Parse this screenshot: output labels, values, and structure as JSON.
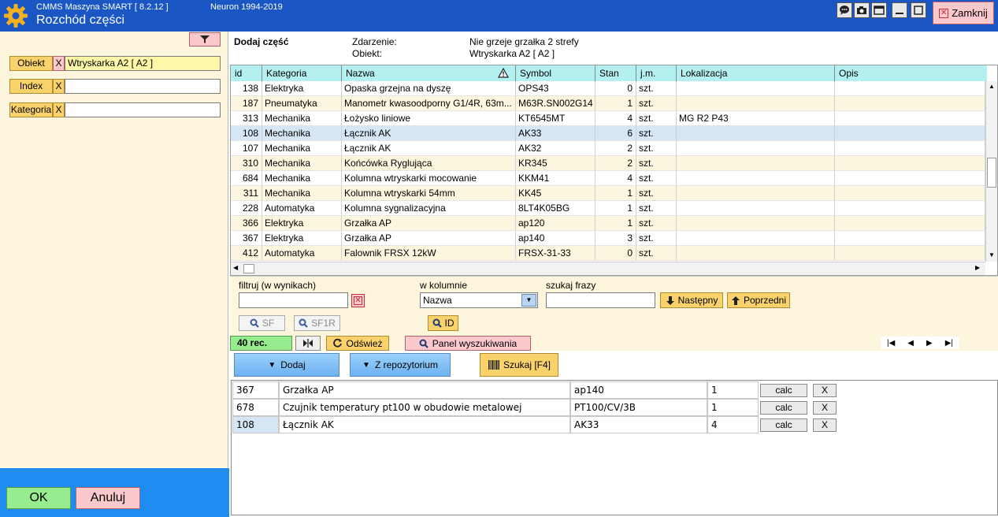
{
  "app": {
    "name": "CMMS Maszyna SMART  [  8.2.12 ]",
    "window_title": "Rozchód części",
    "copyright": "Neuron 1994-2019",
    "close_label": "Zamknij"
  },
  "filters": {
    "obiekt_label": "Obiekt",
    "obiekt_value": "Wtryskarka A2 [ A2 ]",
    "index_label": "Index",
    "index_value": "",
    "kategoria_label": "Kategoria",
    "kategoria_value": "",
    "x_label": "X"
  },
  "footer": {
    "ok_label": "OK",
    "cancel_label": "Anuluj"
  },
  "header": {
    "title": "Dodaj część",
    "zdarzenie_label": "Zdarzenie:",
    "zdarzenie_value": "Nie grzeje grzałka 2 strefy",
    "obiekt_label": "Obiekt:",
    "obiekt_value": "Wtryskarka A2 [ A2 ]"
  },
  "table": {
    "columns": [
      "id",
      "Kategoria",
      "Nazwa",
      "Symbol",
      "Stan",
      "j.m.",
      "Lokalizacja",
      "Opis"
    ],
    "rows": [
      {
        "id": "138",
        "kategoria": "Elektryka",
        "nazwa": "Opaska grzejna na dyszę",
        "symbol": "OPS43",
        "stan": "0",
        "jm": "szt.",
        "lokalizacja": "",
        "opis": ""
      },
      {
        "id": "187",
        "kategoria": "Pneumatyka",
        "nazwa": "Manometr kwasoodporny G1/4R, 63m...",
        "symbol": "M63R.SN002G14",
        "stan": "1",
        "jm": "szt.",
        "lokalizacja": "",
        "opis": ""
      },
      {
        "id": "313",
        "kategoria": "Mechanika",
        "nazwa": "Łożysko liniowe",
        "symbol": "KT6545MT",
        "stan": "4",
        "jm": "szt.",
        "lokalizacja": "MG  R2 P43",
        "opis": ""
      },
      {
        "id": "108",
        "kategoria": "Mechanika",
        "nazwa": "Łącznik AK",
        "symbol": "AK33",
        "stan": "6",
        "jm": "szt.",
        "lokalizacja": "",
        "opis": ""
      },
      {
        "id": "107",
        "kategoria": "Mechanika",
        "nazwa": "Łącznik AK",
        "symbol": "AK32",
        "stan": "2",
        "jm": "szt.",
        "lokalizacja": "",
        "opis": ""
      },
      {
        "id": "310",
        "kategoria": "Mechanika",
        "nazwa": "Końcówka Ryglująca",
        "symbol": "KR345",
        "stan": "2",
        "jm": "szt.",
        "lokalizacja": "",
        "opis": ""
      },
      {
        "id": "684",
        "kategoria": "Mechanika",
        "nazwa": "Kolumna wtryskarki mocowanie",
        "symbol": "KKM41",
        "stan": "4",
        "jm": "szt.",
        "lokalizacja": "",
        "opis": ""
      },
      {
        "id": "311",
        "kategoria": "Mechanika",
        "nazwa": "Kolumna wtryskarki 54mm",
        "symbol": "KK45",
        "stan": "1",
        "jm": "szt.",
        "lokalizacja": "",
        "opis": ""
      },
      {
        "id": "228",
        "kategoria": "Automatyka",
        "nazwa": "Kolumna sygnalizacyjna",
        "symbol": "8LT4K05BG",
        "stan": "1",
        "jm": "szt.",
        "lokalizacja": "",
        "opis": ""
      },
      {
        "id": "366",
        "kategoria": "Elektryka",
        "nazwa": "Grzałka  AP",
        "symbol": "ap120",
        "stan": "1",
        "jm": "szt.",
        "lokalizacja": "",
        "opis": ""
      },
      {
        "id": "367",
        "kategoria": "Elektryka",
        "nazwa": "Grzałka  AP",
        "symbol": "ap140",
        "stan": "3",
        "jm": "szt.",
        "lokalizacja": "",
        "opis": ""
      },
      {
        "id": "412",
        "kategoria": "Automatyka",
        "nazwa": "Falownik FRSX 12kW",
        "symbol": "FRSX-31-33",
        "stan": "0",
        "jm": "szt.",
        "lokalizacja": "",
        "opis": ""
      }
    ]
  },
  "search": {
    "filter_label": "filtruj (w wynikach)",
    "filter_value": "",
    "column_label": "w kolumnie",
    "column_value": "Nazwa",
    "phrase_label": "szukaj frazy",
    "phrase_value": "",
    "next_label": "Następny",
    "prev_label": "Poprzedni",
    "sf_label": "SF",
    "sf1r_label": "SF1R",
    "id_label": "ID"
  },
  "status": {
    "rec_count": "40 rec.",
    "refresh_label": "Odśwież",
    "search_panel_label": "Panel wyszukiwania"
  },
  "actions": {
    "add_label": "Dodaj",
    "repo_label": "Z repozytorium",
    "scan_label": "Szukaj  [F4]"
  },
  "selected": {
    "calc_label": "calc",
    "remove_label": "X",
    "rows": [
      {
        "id": "367",
        "nazwa": "Grzałka  AP",
        "symbol": "ap140",
        "qty": "1"
      },
      {
        "id": "678",
        "nazwa": "Czujnik temperatury pt100 w obudowie metalowej",
        "symbol": "PT100/CV/3B",
        "qty": "1"
      },
      {
        "id": "108",
        "nazwa": "Łącznik AK",
        "symbol": "AK33",
        "qty": "4"
      }
    ]
  },
  "colors": {
    "titlebar": "#1a56c4",
    "header_row": "#b4f0f0",
    "panel_bg": "#fdf5dc",
    "selected_row": "#d6e6f5"
  }
}
